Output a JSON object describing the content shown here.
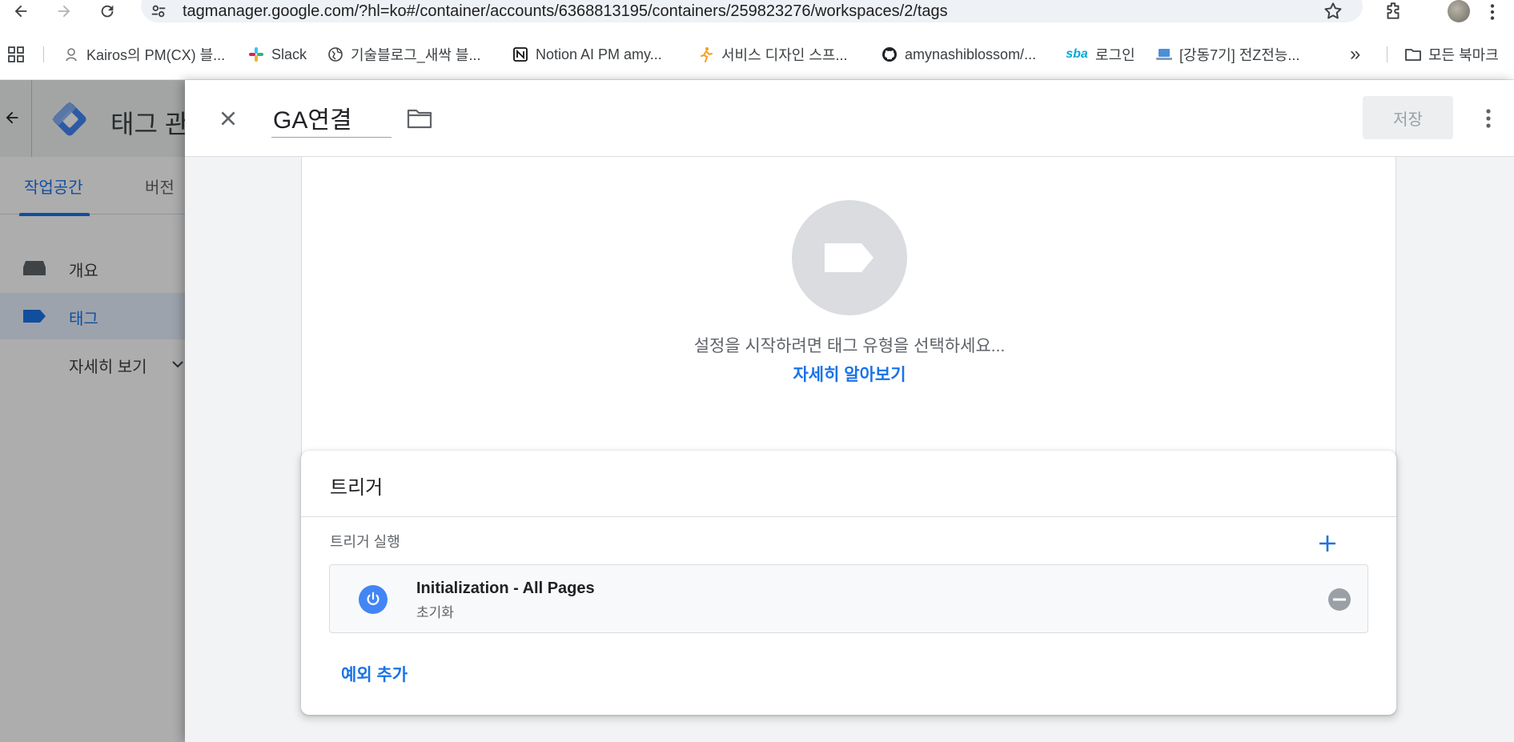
{
  "browser": {
    "url": "tagmanager.google.com/?hl=ko#/container/accounts/6368813195/containers/259823276/workspaces/2/tags"
  },
  "bookmarks": {
    "items": [
      {
        "label": "Kairos의 PM(CX) 블...",
        "icon": "kairos-favicon"
      },
      {
        "label": "Slack",
        "icon": "slack-favicon"
      },
      {
        "label": "기술블로그_새싹 블...",
        "icon": "globe-icon"
      },
      {
        "label": "Notion AI PM amy...",
        "icon": "notion-favicon"
      },
      {
        "label": "서비스 디자인 스프...",
        "icon": "runner-favicon"
      },
      {
        "label": "amynashiblossom/...",
        "icon": "github-favicon"
      },
      {
        "label": "로그인",
        "icon": "sba-favicon",
        "icon_text": "sba"
      },
      {
        "label": "[강동7기] 전Z전능...",
        "icon": "laptop-favicon"
      }
    ],
    "overflow_label": "»",
    "all_bookmarks_label": "모든 북마크"
  },
  "app": {
    "title": "태그 관",
    "tabs": {
      "workspace": "작업공간",
      "versions": "버전"
    },
    "nav": {
      "overview": "개요",
      "tags": "태그",
      "more": "자세히 보기"
    }
  },
  "sheet": {
    "tag_name": "GA연결",
    "save_label": "저장",
    "config": {
      "choose_type_text": "설정을 시작하려면 태그 유형을 선택하세요...",
      "learn_more": "자세히 알아보기"
    },
    "triggering": {
      "title": "트리거",
      "firing_label": "트리거 실행",
      "trigger": {
        "name": "Initialization - All Pages",
        "type": "초기화"
      },
      "add_exception": "예외 추가"
    }
  },
  "colors": {
    "accent": "#1a73e8",
    "trigger_icon": "#4285f4",
    "placeholder_circle": "#dadce0"
  }
}
